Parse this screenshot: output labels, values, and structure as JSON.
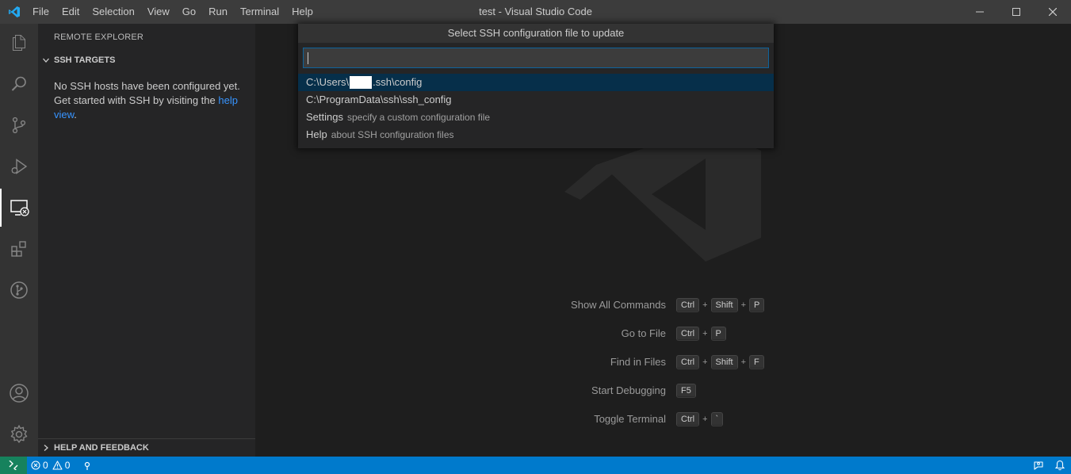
{
  "window": {
    "title": "test - Visual Studio Code",
    "menu": [
      "File",
      "Edit",
      "Selection",
      "View",
      "Go",
      "Run",
      "Terminal",
      "Help"
    ]
  },
  "activity_bar": {
    "items": [
      "files-icon",
      "search-icon",
      "source-control-icon",
      "run-debug-icon",
      "remote-explorer-icon",
      "extensions-icon",
      "git-graph-icon"
    ],
    "bottom": [
      "accounts-icon",
      "manage-gear-icon"
    ],
    "active": "remote-explorer-icon"
  },
  "sidebar": {
    "header": "REMOTE EXPLORER",
    "section_ssh": "SSH TARGETS",
    "message_part1": "No SSH hosts have been configured yet. Get started with SSH by visiting the",
    "link_text": "help view",
    "message_end": ".",
    "section_help": "HELP AND FEEDBACK"
  },
  "quick_pick": {
    "title": "Select SSH configuration file to update",
    "input_value": "",
    "items": [
      {
        "prefix": "C:\\Users\\",
        "suffix": ".ssh\\config",
        "desc": "",
        "selected": true
      },
      {
        "label": "C:\\ProgramData\\ssh\\ssh_config",
        "desc": ""
      },
      {
        "label": "Settings",
        "desc": "specify a custom configuration file"
      },
      {
        "label": "Help",
        "desc": "about SSH configuration files"
      }
    ]
  },
  "shortcuts": [
    {
      "label": "Show All Commands",
      "keys": [
        "Ctrl",
        "Shift",
        "P"
      ]
    },
    {
      "label": "Go to File",
      "keys": [
        "Ctrl",
        "P"
      ]
    },
    {
      "label": "Find in Files",
      "keys": [
        "Ctrl",
        "Shift",
        "F"
      ]
    },
    {
      "label": "Start Debugging",
      "keys": [
        "F5"
      ]
    },
    {
      "label": "Toggle Terminal",
      "keys": [
        "Ctrl",
        "`"
      ]
    }
  ],
  "status_bar": {
    "errors": "0",
    "warnings": "0"
  },
  "colors": {
    "accent": "#007acc",
    "remote": "#16825d",
    "selection": "#062f4a",
    "link": "#3794ff"
  }
}
